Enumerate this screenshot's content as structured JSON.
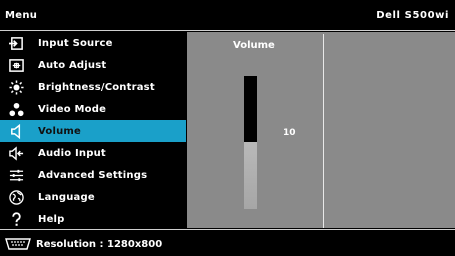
{
  "header": {
    "title": "Menu",
    "model": "Dell S500wi"
  },
  "menu": {
    "items": [
      {
        "label": "Input Source",
        "icon": "input-source-icon"
      },
      {
        "label": "Auto Adjust",
        "icon": "auto-adjust-icon"
      },
      {
        "label": "Brightness/Contrast",
        "icon": "brightness-icon"
      },
      {
        "label": "Video Mode",
        "icon": "video-mode-icon"
      },
      {
        "label": "Volume",
        "icon": "speaker-icon",
        "selected": true
      },
      {
        "label": "Audio Input",
        "icon": "audio-input-icon"
      },
      {
        "label": "Advanced Settings",
        "icon": "settings-sliders-icon"
      },
      {
        "label": "Language",
        "icon": "globe-icon"
      },
      {
        "label": "Help",
        "icon": "question-icon"
      }
    ]
  },
  "panel": {
    "title": "Volume",
    "value": "10",
    "level_fraction": 0.5
  },
  "footer": {
    "text": "Resolution : 1280x800",
    "icon": "monitor-connector-icon"
  },
  "colors": {
    "selected": "#1aa0c9",
    "panel": "#8a8a8a",
    "background": "#000000"
  }
}
